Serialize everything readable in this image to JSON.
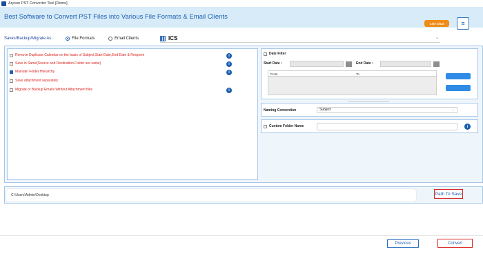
{
  "window": {
    "title": "Aryson PST Converter Tool [Demo]",
    "icon": "app-logo-icon"
  },
  "banner": {
    "heading": "Best Software to Convert PST Files into Various File Formats & Email Clients",
    "live_chat_label": "Live Chat",
    "menu_icon": "hamburger-icon",
    "colors": {
      "banner_bg": "#d7ebf8",
      "heading": "#1b5fb0",
      "live_chat": "#f08c1a"
    }
  },
  "save_as": {
    "label": "Saves/Backup/Migrate As :",
    "options": [
      {
        "label": "File Formats",
        "selected": true
      },
      {
        "label": "Email Clients",
        "selected": false
      }
    ],
    "format_selected": "ICS",
    "format_icon": "ics-file-icon"
  },
  "options": [
    {
      "label": "Remove Duplicate Calendar on the basis of Subject,Start-Date,End-Date & Recipent",
      "checked": false,
      "info": true
    },
    {
      "label": "Save in Same(Source and Destination Folder are same)",
      "checked": false,
      "info": true
    },
    {
      "label": "Maintain Folder Hierarchy",
      "checked": true,
      "info": true
    },
    {
      "label": "Save attachment separately",
      "checked": false,
      "info": false
    },
    {
      "label": "Migrate or Backup Emails Without Attachment files",
      "checked": false,
      "info": true
    }
  ],
  "date_filter": {
    "label": "Date Filter",
    "checked": false,
    "start_label": "Start Date :",
    "end_label": "End Date :",
    "start_value": "",
    "end_value": "",
    "table_headers": [
      "From",
      "To"
    ]
  },
  "naming": {
    "label": "Naming Convention",
    "selected": "Subject"
  },
  "custom_folder": {
    "label": "Custom Folder Name",
    "checked": false,
    "value": ""
  },
  "path": {
    "value": "C:\\Users\\Admin\\Desktop",
    "button_label": "Path To Save"
  },
  "footer": {
    "previous_label": "Previous",
    "convert_label": "Convert"
  }
}
